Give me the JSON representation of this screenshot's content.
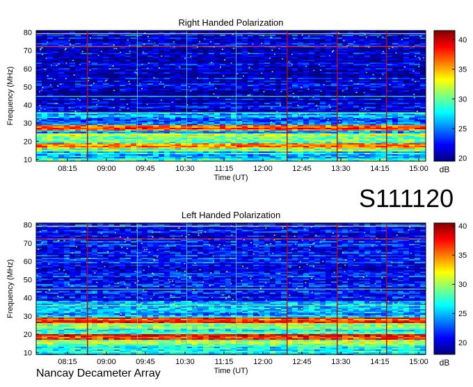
{
  "page": {
    "big_label": "S111120",
    "footer_label": "Nancay Decameter Array"
  },
  "chart_data": [
    {
      "type": "heatmap",
      "title": "Right Handed Polarization",
      "xlabel": "Time (UT)",
      "ylabel": "Frequency (MHz)",
      "x_ticks": [
        "08:15",
        "09:00",
        "09:45",
        "10:30",
        "11:15",
        "12:00",
        "12:45",
        "13:30",
        "14:15",
        "15:00"
      ],
      "y_ticks": [
        10,
        20,
        30,
        40,
        50,
        60,
        70,
        80
      ],
      "ylim": [
        9,
        81
      ],
      "colorbar": {
        "label": "dB",
        "ticks": [
          20,
          25,
          30,
          35,
          40
        ],
        "range": [
          19.5,
          41.5
        ]
      },
      "bands": [
        {
          "from": 9,
          "to": 14,
          "level": 27
        },
        {
          "from": 14,
          "to": 16,
          "level": 30
        },
        {
          "from": 16,
          "to": 19,
          "level": 35
        },
        {
          "from": 19,
          "to": 21,
          "level": 29
        },
        {
          "from": 21,
          "to": 24,
          "level": 31
        },
        {
          "from": 24,
          "to": 26,
          "level": 27
        },
        {
          "from": 26,
          "to": 29,
          "level": 37
        },
        {
          "from": 29,
          "to": 33,
          "level": 24
        },
        {
          "from": 33,
          "to": 36,
          "level": 26
        },
        {
          "from": 36,
          "to": 81,
          "level": 21
        }
      ]
    },
    {
      "type": "heatmap",
      "title": "Left Handed Polarization",
      "xlabel": "Time (UT)",
      "ylabel": "Frequency (MHz)",
      "x_ticks": [
        "08:15",
        "09:00",
        "09:45",
        "10:30",
        "11:15",
        "12:00",
        "12:45",
        "13:30",
        "14:15",
        "15:00"
      ],
      "y_ticks": [
        10,
        20,
        30,
        40,
        50,
        60,
        70,
        80
      ],
      "ylim": [
        9,
        81
      ],
      "colorbar": {
        "label": "dB",
        "ticks": [
          20,
          25,
          30,
          35,
          40
        ],
        "range": [
          18,
          40.5
        ]
      },
      "bands": [
        {
          "from": 9,
          "to": 14,
          "level": 26
        },
        {
          "from": 14,
          "to": 17,
          "level": 30
        },
        {
          "from": 17,
          "to": 20,
          "level": 36
        },
        {
          "from": 20,
          "to": 23,
          "level": 28
        },
        {
          "from": 23,
          "to": 26,
          "level": 30
        },
        {
          "from": 26,
          "to": 29,
          "level": 36
        },
        {
          "from": 29,
          "to": 33,
          "level": 24
        },
        {
          "from": 33,
          "to": 38,
          "level": 25
        },
        {
          "from": 38,
          "to": 81,
          "level": 21
        }
      ]
    }
  ]
}
